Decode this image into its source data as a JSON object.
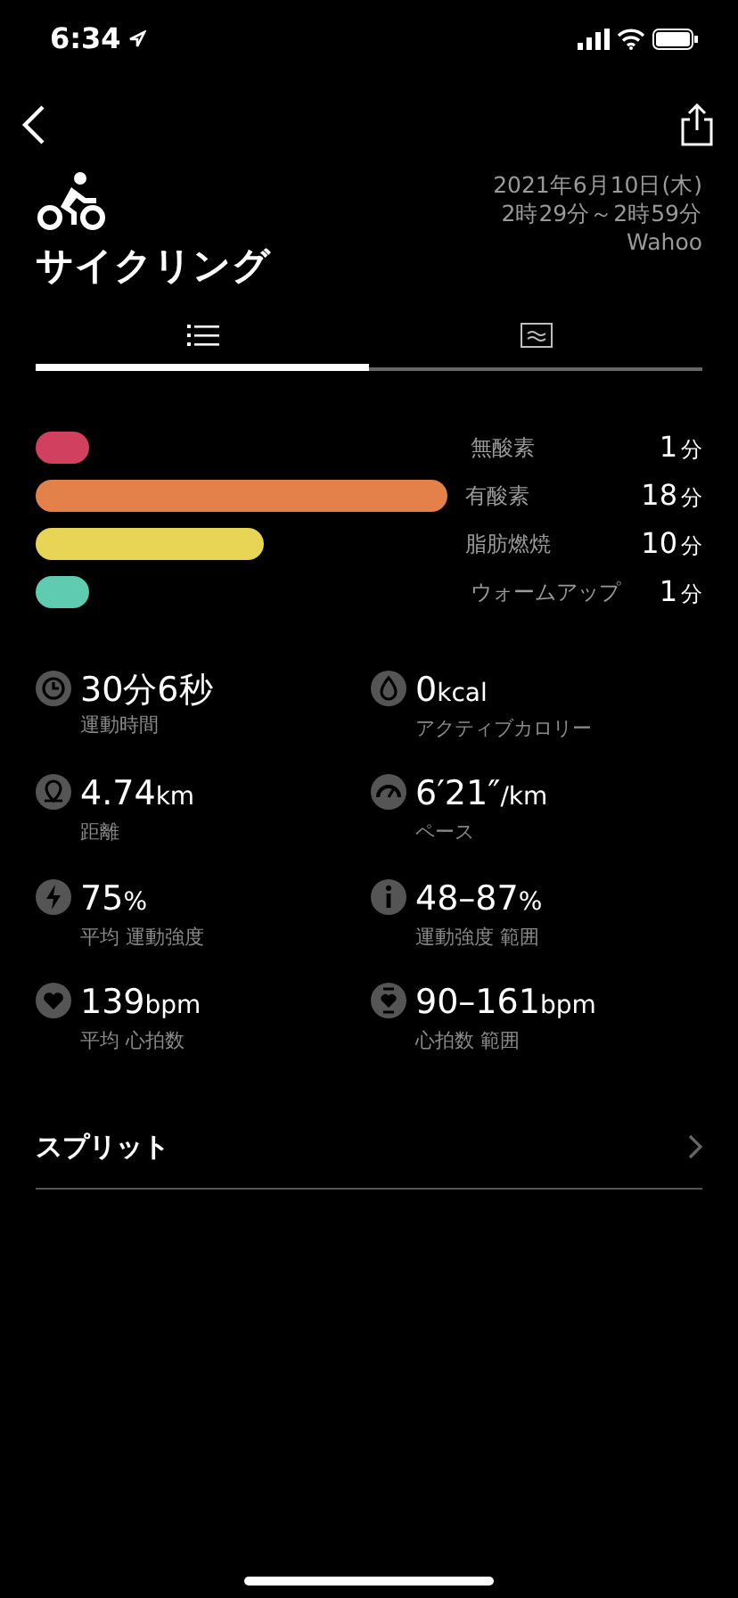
{
  "status_bar": {
    "time": "6:34"
  },
  "header": {
    "title": "サイクリング",
    "date": "2021年6月10日(木)",
    "time_range": "2時29分～2時59分",
    "source": "Wahoo"
  },
  "tabs": [
    {
      "kind": "list",
      "selected": true
    },
    {
      "kind": "chart",
      "selected": false
    }
  ],
  "zones": [
    {
      "name": "無酸素",
      "value": "1",
      "unit": "分",
      "color": "#d1405f"
    },
    {
      "name": "有酸素",
      "value": "18",
      "unit": "分",
      "color": "#e4814a"
    },
    {
      "name": "脂肪燃焼",
      "value": "10",
      "unit": "分",
      "color": "#e8d455"
    },
    {
      "name": "ウォームアップ",
      "value": "1",
      "unit": "分",
      "color": "#5fcbb0"
    }
  ],
  "stats": [
    {
      "kind": "clock",
      "value": "30分6秒",
      "label": "運動時間"
    },
    {
      "kind": "drop",
      "value": "0",
      "unit": "kcal",
      "label": "アクティブカロリー"
    },
    {
      "kind": "pin",
      "value": "4.74",
      "unit": "km",
      "label": "距離"
    },
    {
      "kind": "gauge",
      "value": "6′21″",
      "unit": "/km",
      "label": "ペース"
    },
    {
      "kind": "bolt",
      "value": "75",
      "unit": "%",
      "label": "平均 運動強度"
    },
    {
      "kind": "info",
      "value": "48–87",
      "unit": "%",
      "label": "運動強度 範囲"
    },
    {
      "kind": "heart",
      "value": "139",
      "unit": "bpm",
      "label": "平均 心拍数"
    },
    {
      "kind": "heart-range",
      "value": "90–161",
      "unit": "bpm",
      "label": "心拍数 範囲"
    }
  ],
  "split": {
    "label": "スプリット"
  }
}
